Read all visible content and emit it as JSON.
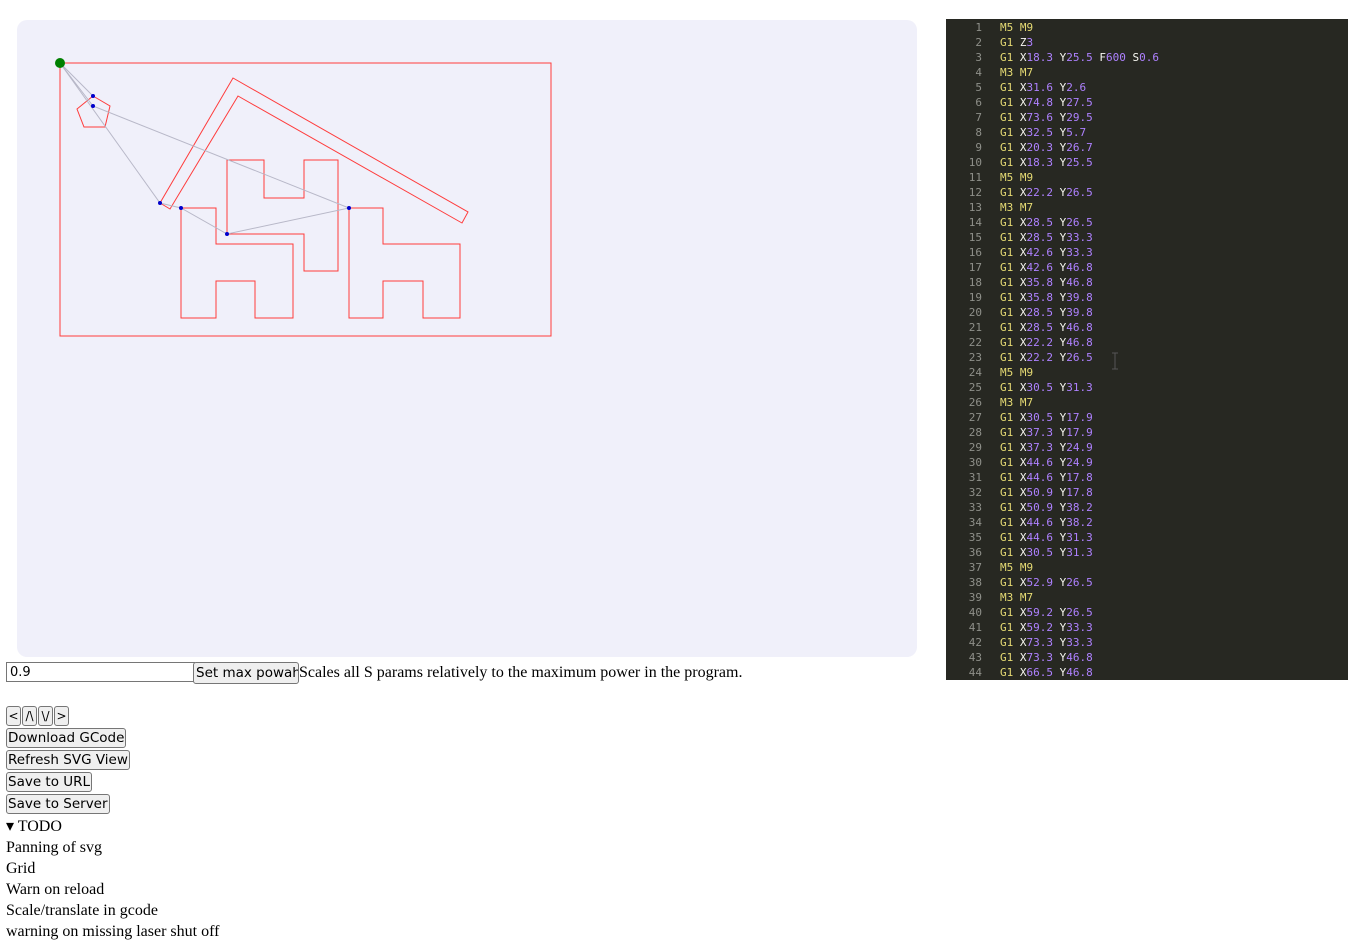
{
  "editor": {
    "lines": [
      "M5 M9",
      "G1 Z3",
      "G1 X18.3 Y25.5 F600 S0.6",
      "M3 M7",
      "G1 X31.6 Y2.6",
      "G1 X74.8 Y27.5",
      "G1 X73.6 Y29.5",
      "G1 X32.5 Y5.7",
      "G1 X20.3 Y26.7",
      "G1 X18.3 Y25.5",
      "M5 M9",
      "G1 X22.2 Y26.5",
      "M3 M7",
      "G1 X28.5 Y26.5",
      "G1 X28.5 Y33.3",
      "G1 X42.6 Y33.3",
      "G1 X42.6 Y46.8",
      "G1 X35.8 Y46.8",
      "G1 X35.8 Y39.8",
      "G1 X28.5 Y39.8",
      "G1 X28.5 Y46.8",
      "G1 X22.2 Y46.8",
      "G1 X22.2 Y26.5",
      "M5 M9",
      "G1 X30.5 Y31.3",
      "M3 M7",
      "G1 X30.5 Y17.9",
      "G1 X37.3 Y17.9",
      "G1 X37.3 Y24.9",
      "G1 X44.6 Y24.9",
      "G1 X44.6 Y17.8",
      "G1 X50.9 Y17.8",
      "G1 X50.9 Y38.2",
      "G1 X44.6 Y38.2",
      "G1 X44.6 Y31.3",
      "G1 X30.5 Y31.3",
      "M5 M9",
      "G1 X52.9 Y26.5",
      "M3 M7",
      "G1 X59.2 Y26.5",
      "G1 X59.2 Y33.3",
      "G1 X73.3 Y33.3",
      "G1 X73.3 Y46.8",
      "G1 X66.5 Y46.8"
    ],
    "colors": {
      "background": "#272822",
      "command": "#e6db74",
      "letter": "#f8f8f2",
      "number": "#ae81ff",
      "gutter": "#8f908a"
    }
  },
  "preview": {
    "colors": {
      "cut": "#ff3b3b",
      "travel": "#b8b8c8",
      "start": "#008000",
      "vertex": "#0000cc",
      "background": "#f0f0fa"
    }
  },
  "power": {
    "value": "0.9",
    "button_label": "Set max powah",
    "description": "Scales all S params relatively to the maximum power in the program."
  },
  "nav": {
    "prev_label": "<",
    "up_label": "/\\",
    "down_label": "\\/",
    "next_label": ">"
  },
  "buttons": {
    "download": "Download GCode",
    "refresh": "Refresh SVG View",
    "save_url": "Save to URL",
    "save_server": "Save to Server"
  },
  "todo": {
    "summary": "▾ TODO",
    "items": [
      "Panning of svg",
      "Grid",
      "Warn on reload",
      "Scale/translate in gcode",
      "warning on missing laser shut off"
    ]
  }
}
